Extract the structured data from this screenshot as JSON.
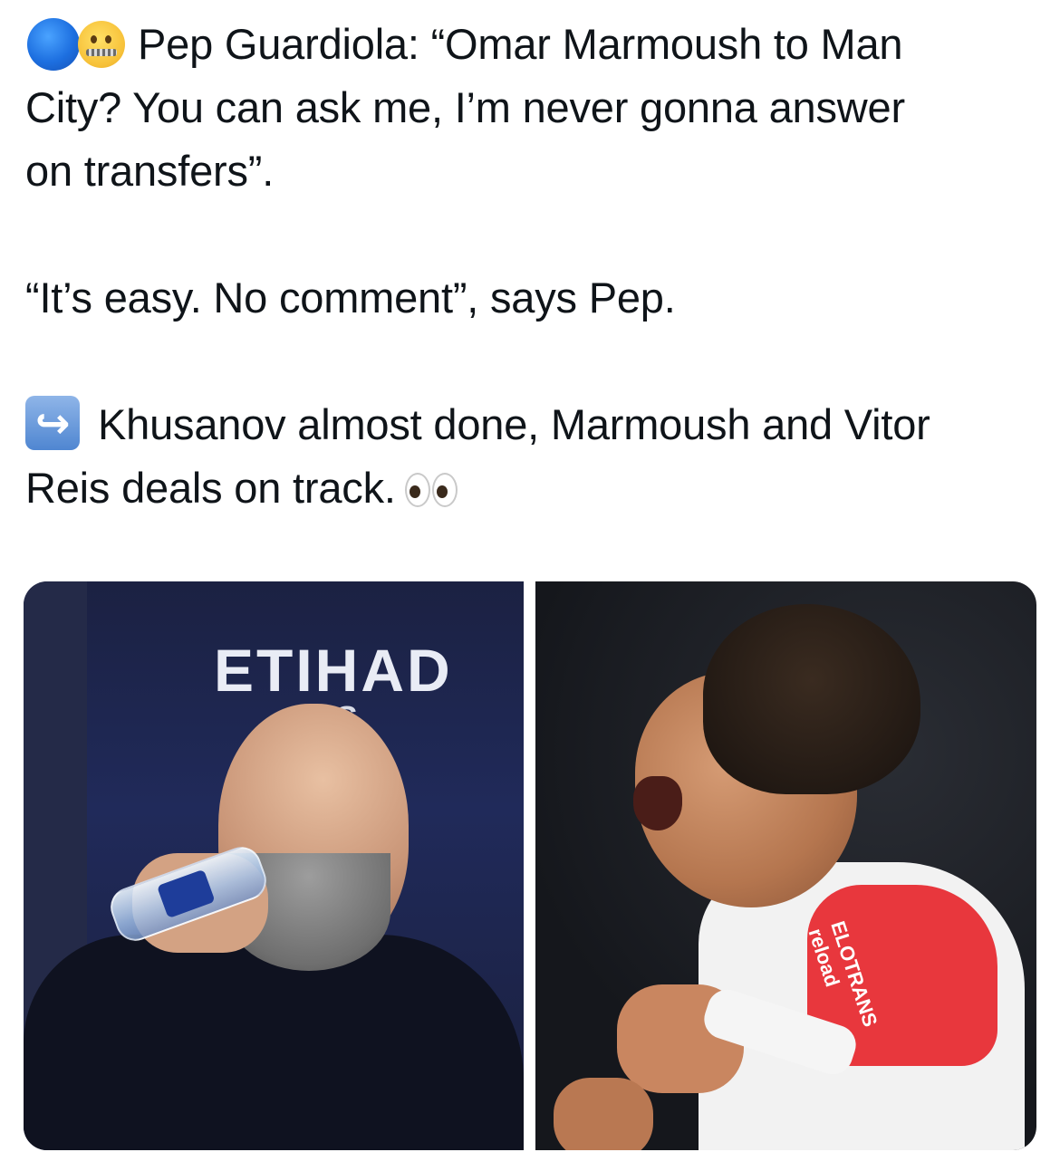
{
  "post": {
    "lines": [
      "Pep Guardiola: “Omar Marmoush to Man",
      "City? You can ask me, I’m never gonna answer",
      "on transfers”.",
      "“It’s easy. No comment”, says Pep.",
      "Khusanov almost done, Marmoush and Vitor",
      "Reis deals on track."
    ],
    "icons": {
      "first": "blue-circle-icon",
      "second": "zipper-mouth-face-icon",
      "arrow": "right-arrow-curving-left-icon",
      "eyes": "eyes-icon"
    }
  },
  "photos": {
    "left": {
      "banner_main": "ETIHAD",
      "banner_sub": "AYS"
    },
    "right": {
      "sponsor_line1": "ELOTRANS",
      "sponsor_line2": "reload"
    }
  },
  "colors": {
    "text": "#0f1419",
    "background": "#ffffff",
    "blue_circle": "#1d6fe0",
    "jersey_red": "#e8373d"
  }
}
